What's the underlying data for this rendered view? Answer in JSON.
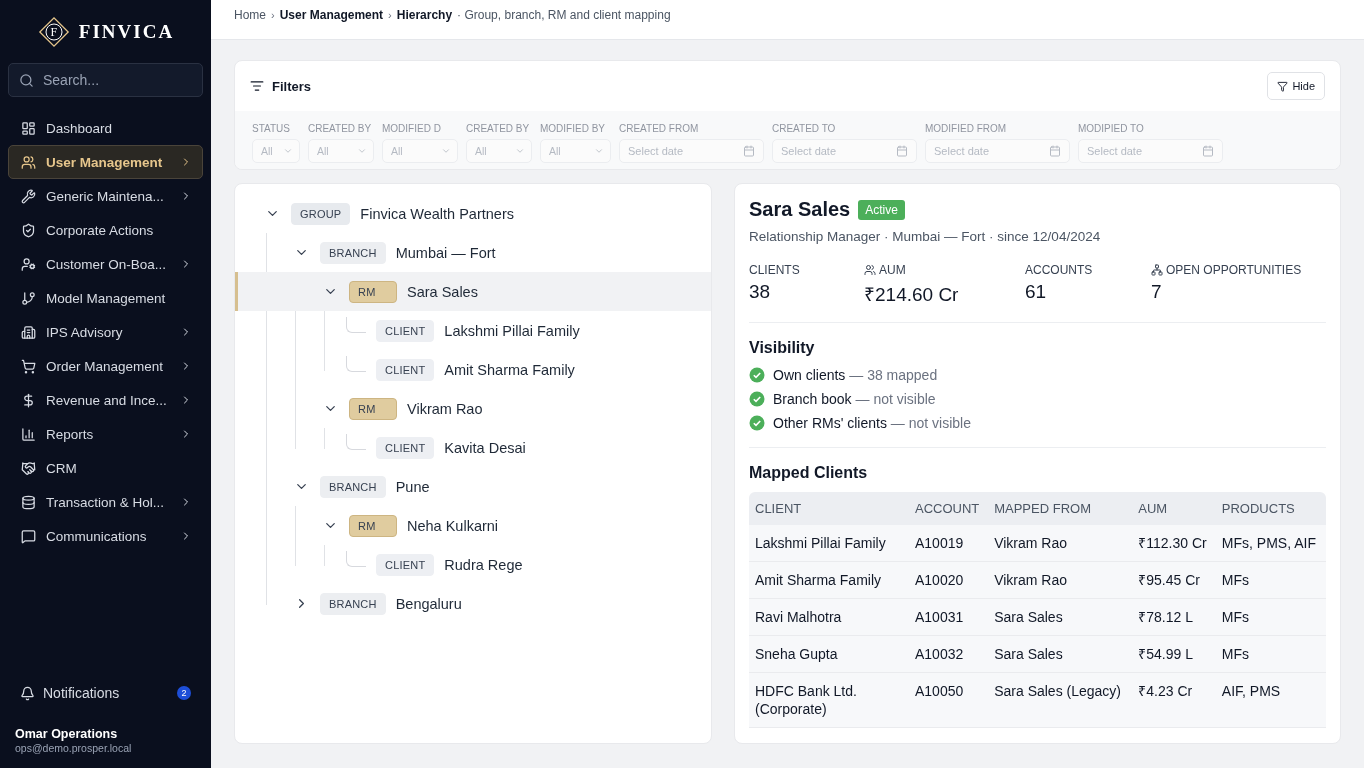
{
  "brand": {
    "name": "FINVICA",
    "monogram": "F"
  },
  "search": {
    "placeholder": "Search..."
  },
  "nav": [
    {
      "label": "Dashboard",
      "selected": false,
      "expandable": false
    },
    {
      "label": "User Management",
      "selected": true,
      "expandable": true
    },
    {
      "label": "Generic Maintena...",
      "selected": false,
      "expandable": true
    },
    {
      "label": "Corporate Actions",
      "selected": false,
      "expandable": false
    },
    {
      "label": "Customer On-Boa...",
      "selected": false,
      "expandable": true
    },
    {
      "label": "Model Management",
      "selected": false,
      "expandable": false
    },
    {
      "label": "IPS Advisory",
      "selected": false,
      "expandable": true
    },
    {
      "label": "Order Management",
      "selected": false,
      "expandable": true
    },
    {
      "label": "Revenue and Ince...",
      "selected": false,
      "expandable": true
    },
    {
      "label": "Reports",
      "selected": false,
      "expandable": true
    },
    {
      "label": "CRM",
      "selected": false,
      "expandable": false
    },
    {
      "label": "Transaction & Hol...",
      "selected": false,
      "expandable": true
    },
    {
      "label": "Communications",
      "selected": false,
      "expandable": true
    }
  ],
  "notifications": {
    "label": "Notifications",
    "count": "2"
  },
  "user": {
    "name": "Omar Operations",
    "email": "ops@demo.prosper.local"
  },
  "breadcrumb": {
    "separator": "›",
    "items": [
      "Home",
      "User Management",
      "Hierarchy"
    ],
    "description": "· Group, branch, RM and client mapping"
  },
  "filters": {
    "disabled": true,
    "title": "Filters",
    "hide_button": "Hide",
    "fields": [
      {
        "kind": "select",
        "label": "STATUS",
        "value": "All"
      },
      {
        "kind": "select",
        "label": "CREATED BY",
        "value": "All"
      },
      {
        "kind": "select",
        "label": "MODIFIED D",
        "value": "All"
      },
      {
        "kind": "select",
        "label": "CREATED BY",
        "value": "All"
      },
      {
        "kind": "select",
        "label": "MODIFIED BY",
        "value": "All"
      },
      {
        "kind": "date",
        "label": "CREATED FROM",
        "placeholder": "Select date"
      },
      {
        "kind": "date",
        "label": "CREATED TO",
        "placeholder": "Select date"
      },
      {
        "kind": "date",
        "label": "MODIFIED FROM",
        "placeholder": "Select date"
      },
      {
        "kind": "date",
        "label": "MODIPIED TO",
        "placeholder": "Select date"
      }
    ]
  },
  "tree": [
    {
      "kind": "group",
      "badge": "GROUP",
      "name": "Finvica Wealth Partners",
      "expanded": true,
      "selected": false,
      "children": [
        {
          "kind": "branch",
          "badge": "BRANCH",
          "name": "Mumbai — Fort",
          "expanded": true,
          "selected": false,
          "children": [
            {
              "kind": "rm",
              "badge": "RM",
              "name": "Sara Sales",
              "expanded": true,
              "selected": true,
              "children": [
                {
                  "kind": "client",
                  "badge": "CLIENT",
                  "name": "Lakshmi Pillai Family",
                  "selected": false
                },
                {
                  "kind": "client",
                  "badge": "CLIENT",
                  "name": "Amit Sharma Family",
                  "selected": false
                }
              ]
            },
            {
              "kind": "rm",
              "badge": "RM",
              "name": "Vikram Rao",
              "expanded": true,
              "selected": false,
              "children": [
                {
                  "kind": "client",
                  "badge": "CLIENT",
                  "name": "Kavita Desai",
                  "selected": false
                }
              ]
            }
          ]
        },
        {
          "kind": "branch",
          "badge": "BRANCH",
          "name": "Pune",
          "expanded": true,
          "selected": false,
          "children": [
            {
              "kind": "rm",
              "badge": "RM",
              "name": "Neha Kulkarni",
              "expanded": true,
              "selected": false,
              "children": [
                {
                  "kind": "client",
                  "badge": "CLIENT",
                  "name": "Rudra Rege",
                  "selected": false
                }
              ]
            }
          ]
        },
        {
          "kind": "branch",
          "badge": "BRANCH",
          "name": "Bengaluru",
          "expanded": false,
          "selected": false
        }
      ]
    }
  ],
  "detail": {
    "name": "Sara Sales",
    "status": "Active",
    "subtitle": "Relationship Manager · Mumbai — Fort · since 12/04/2024",
    "stats": [
      {
        "label": "CLIENTS",
        "value": "38",
        "with_icon": false
      },
      {
        "label": "AUM",
        "value": "₹214.60 Cr",
        "with_icon": true
      },
      {
        "label": "ACCOUNTS",
        "value": "61",
        "with_icon": false
      },
      {
        "label": "OPEN OPPORTUNITIES",
        "value": "7",
        "with_icon": true
      }
    ],
    "visibility": {
      "title": "Visibility",
      "items": [
        {
          "label": "Own clients",
          "note": "— 38 mapped",
          "checked": true
        },
        {
          "label": "Branch book",
          "note": "— not visible",
          "checked": true
        },
        {
          "label": "Other RMs' clients",
          "note": "— not visible",
          "checked": true
        }
      ]
    },
    "mapped": {
      "title": "Mapped Clients",
      "columns": [
        "CLIENT",
        "ACCOUNT",
        "MAPPED FROM",
        "AUM",
        "PRODUCTS"
      ],
      "rows": [
        [
          "Lakshmi Pillai Family",
          "A10019",
          "Vikram Rao",
          "₹112.30 Cr",
          "MFs, PMS, AIF"
        ],
        [
          "Amit Sharma Family",
          "A10020",
          "Vikram Rao",
          "₹95.45 Cr",
          "MFs"
        ],
        [
          "Ravi Malhotra",
          "A10031",
          "Sara Sales",
          "₹78.12 L",
          "MFs"
        ],
        [
          "Sneha Gupta",
          "A10032",
          "Sara Sales",
          "₹54.99 L",
          "MFs"
        ],
        [
          "HDFC Bank Ltd. (Corporate)",
          "A10050",
          "Sara Sales (Legacy)",
          "₹4.23 Cr",
          "AIF, PMS"
        ]
      ]
    }
  }
}
